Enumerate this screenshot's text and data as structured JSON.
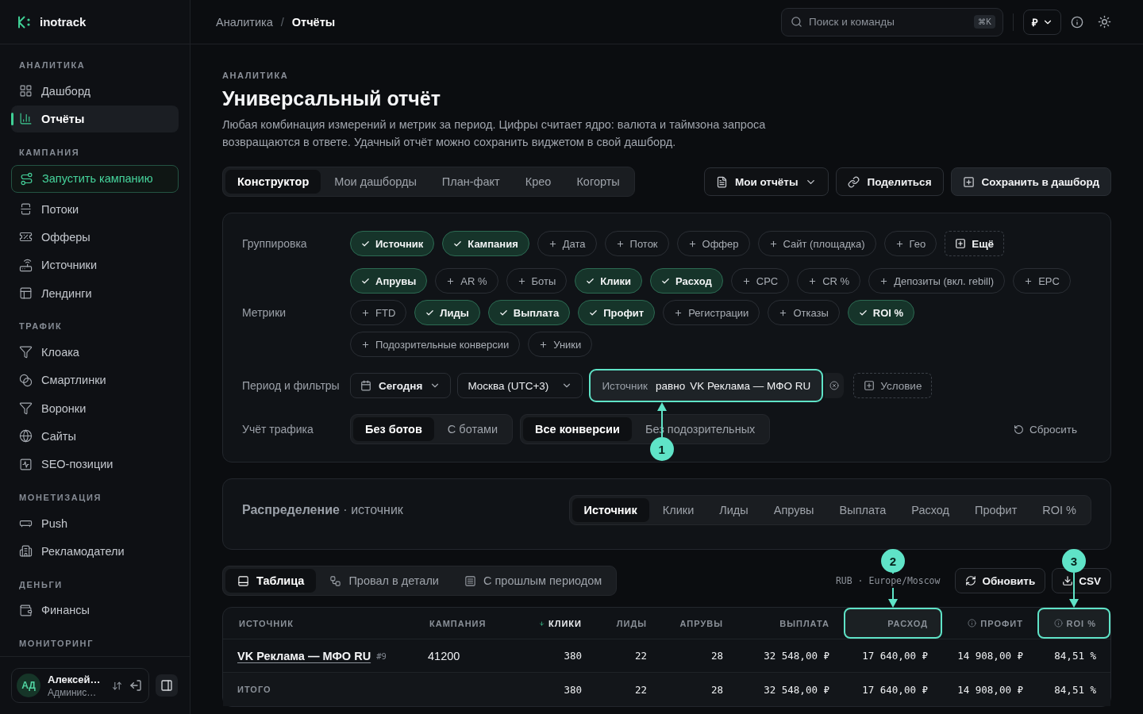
{
  "sidebar": {
    "brand": "inotrack",
    "sections": [
      {
        "title": "АНАЛИТИКА",
        "items": [
          {
            "label": "Дашборд",
            "kind": "link",
            "selected": false
          },
          {
            "label": "Отчёты",
            "kind": "link",
            "selected": true
          }
        ]
      },
      {
        "title": "КАМПАНИЯ",
        "items": [
          {
            "label": "Запустить кампанию",
            "kind": "action",
            "selected": false
          },
          {
            "label": "Потоки",
            "kind": "link",
            "selected": false
          },
          {
            "label": "Офферы",
            "kind": "link",
            "selected": false
          },
          {
            "label": "Источники",
            "kind": "link",
            "selected": false
          },
          {
            "label": "Лендинги",
            "kind": "link",
            "selected": false
          }
        ]
      },
      {
        "title": "ТРАФИК",
        "items": [
          {
            "label": "Клоака",
            "kind": "link",
            "selected": false
          },
          {
            "label": "Смартлинки",
            "kind": "link",
            "selected": false
          },
          {
            "label": "Воронки",
            "kind": "link",
            "selected": false
          },
          {
            "label": "Сайты",
            "kind": "link",
            "selected": false
          },
          {
            "label": "SEO-позиции",
            "kind": "link",
            "selected": false
          }
        ]
      },
      {
        "title": "МОНЕТИЗАЦИЯ",
        "items": [
          {
            "label": "Push",
            "kind": "link",
            "selected": false
          },
          {
            "label": "Рекламодатели",
            "kind": "link",
            "selected": false
          }
        ]
      },
      {
        "title": "ДЕНЬГИ",
        "items": [
          {
            "label": "Финансы",
            "kind": "link",
            "selected": false
          }
        ]
      },
      {
        "title": "МОНИТОРИНГ"
      }
    ],
    "user": {
      "initials": "АД",
      "name": "Алексей…",
      "role": "Админис…"
    }
  },
  "header": {
    "breadcrumbs": [
      {
        "label": "Аналитика",
        "selected": false
      },
      {
        "label": "Отчёты",
        "selected": true
      }
    ],
    "separator": "/",
    "search": {
      "placeholder": "Поиск и команды",
      "shortcut": "⌘K"
    },
    "currency": "₽"
  },
  "page": {
    "eyebrow": "АНАЛИТИКА",
    "title": "Универсальный отчёт",
    "description": "Любая комбинация измерений и метрик за период. Цифры считает ядро: валюта и таймзона запроса возвращаются в ответе. Удачный отчёт можно сохранить виджетом в свой дашборд.",
    "tabs": [
      {
        "label": "Конструктор",
        "selected": true
      },
      {
        "label": "Мои дашборды",
        "selected": false
      },
      {
        "label": "План-факт",
        "selected": false
      },
      {
        "label": "Крео",
        "selected": false
      },
      {
        "label": "Когорты",
        "selected": false
      }
    ],
    "actions": [
      {
        "label": "Мои отчёты",
        "kind": "outline",
        "dropdown": true
      },
      {
        "label": "Поделиться",
        "kind": "outline",
        "dropdown": false
      },
      {
        "label": "Сохранить в дашборд",
        "kind": "filled",
        "dropdown": false
      }
    ]
  },
  "builder": {
    "grouping": {
      "label": "Группировка",
      "chips": [
        {
          "label": "Источник",
          "selected": true
        },
        {
          "label": "Кампания",
          "selected": true
        },
        {
          "label": "Дата",
          "selected": false
        },
        {
          "label": "Поток",
          "selected": false
        },
        {
          "label": "Оффер",
          "selected": false
        },
        {
          "label": "Сайт (площадка)",
          "selected": false
        },
        {
          "label": "Гео",
          "selected": false
        }
      ],
      "more": "Ещё"
    },
    "metrics": {
      "label": "Метрики",
      "chips": [
        {
          "label": "Апрувы",
          "selected": true
        },
        {
          "label": "AR %",
          "selected": false
        },
        {
          "label": "Боты",
          "selected": false
        },
        {
          "label": "Клики",
          "selected": true
        },
        {
          "label": "Расход",
          "selected": true
        },
        {
          "label": "CPC",
          "selected": false
        },
        {
          "label": "CR %",
          "selected": false
        },
        {
          "label": "Депозиты (вкл. rebill)",
          "selected": false
        },
        {
          "label": "EPC",
          "selected": false
        },
        {
          "label": "FTD",
          "selected": false
        },
        {
          "label": "Лиды",
          "selected": true
        },
        {
          "label": "Выплата",
          "selected": true
        },
        {
          "label": "Профит",
          "selected": true
        },
        {
          "label": "Регистрации",
          "selected": false
        },
        {
          "label": "Отказы",
          "selected": false
        },
        {
          "label": "ROI %",
          "selected": true
        },
        {
          "label": "Подозрительные конверсии",
          "selected": false
        },
        {
          "label": "Уники",
          "selected": false
        }
      ]
    },
    "filters": {
      "label": "Период и фильтры",
      "period": "Сегодня",
      "timezone": "Москва (UTC+3)",
      "conditions": [
        {
          "field": "Источник",
          "operator": "равно",
          "value": "VK Реклама — МФО RU",
          "callout": "1"
        }
      ],
      "add": "Условие"
    },
    "traffic": {
      "label": "Учёт трафика",
      "groups": [
        {
          "options": [
            {
              "label": "Без ботов",
              "selected": true
            },
            {
              "label": "С ботами",
              "selected": false
            }
          ]
        },
        {
          "options": [
            {
              "label": "Все конверсии",
              "selected": true
            },
            {
              "label": "Без подозрительных",
              "selected": false
            }
          ]
        }
      ],
      "reset": "Сбросить"
    }
  },
  "distribution": {
    "title": "**Распределение** · источник",
    "tabs": [
      {
        "label": "Источник",
        "selected": true
      },
      {
        "label": "Клики",
        "selected": false
      },
      {
        "label": "Лиды",
        "selected": false
      },
      {
        "label": "Апрувы",
        "selected": false
      },
      {
        "label": "Выплата",
        "selected": false
      },
      {
        "label": "Расход",
        "selected": false
      },
      {
        "label": "Профит",
        "selected": false
      },
      {
        "label": "ROI %",
        "selected": false
      }
    ]
  },
  "results": {
    "tabs": [
      {
        "label": "Таблица",
        "selected": true
      },
      {
        "label": "Провал в детали",
        "selected": false
      },
      {
        "label": "С прошлым периодом",
        "selected": false
      }
    ],
    "meta": "RUB · Europe/Moscow",
    "refresh": "Обновить",
    "export": "CSV"
  },
  "table": {
    "columns": [
      {
        "label": "ИСТОЧНИК",
        "sorted": false,
        "info": false
      },
      {
        "label": "КАМПАНИЯ",
        "sorted": false,
        "info": false
      },
      {
        "label": "КЛИКИ",
        "sorted": true,
        "info": false
      },
      {
        "label": "ЛИДЫ",
        "sorted": false,
        "info": false
      },
      {
        "label": "АПРУВЫ",
        "sorted": false,
        "info": false
      },
      {
        "label": "ВЫПЛАТА",
        "sorted": false,
        "info": false
      },
      {
        "label": "РАСХОД",
        "sorted": false,
        "info": false,
        "callout": "2"
      },
      {
        "label": "ПРОФИТ",
        "sorted": false,
        "info": true
      },
      {
        "label": "ROI %",
        "sorted": false,
        "info": true,
        "callout": "3"
      }
    ],
    "rows": [
      {
        "source": "VK Реклама — МФО RU",
        "tag": "#9",
        "campaign": "41200",
        "values": [
          "380",
          "22",
          "28",
          "32 548,00 ₽",
          "17 640,00 ₽",
          "14 908,00 ₽",
          "84,51 %"
        ]
      }
    ],
    "totals": {
      "label": "ИТОГО",
      "values": [
        "380",
        "22",
        "28",
        "32 548,00 ₽",
        "17 640,00 ₽",
        "14 908,00 ₽",
        "84,51 %"
      ]
    }
  }
}
